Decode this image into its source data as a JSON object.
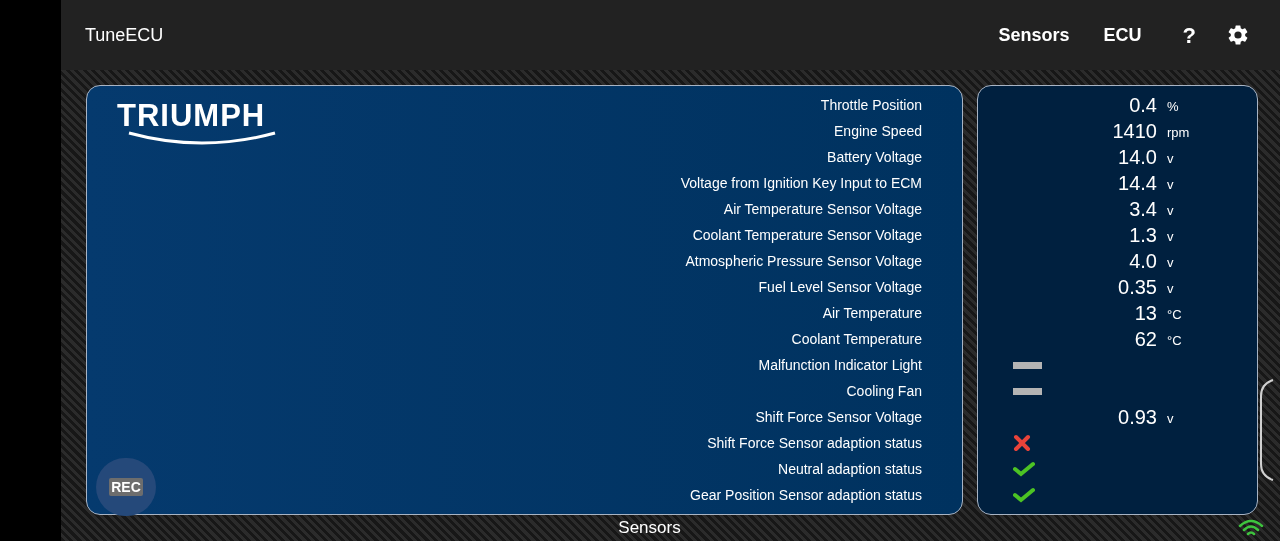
{
  "app_bar": {
    "title": "TuneECU",
    "tabs": [
      {
        "label": "Sensors"
      },
      {
        "label": "ECU"
      }
    ],
    "help": "?"
  },
  "logo": "TRIUMPH",
  "record_button": "REC",
  "sensors": [
    {
      "name": "Throttle Position",
      "kind": "reading",
      "value": "0.4",
      "unit": "%"
    },
    {
      "name": "Engine Speed",
      "kind": "reading",
      "value": "1410",
      "unit": "rpm"
    },
    {
      "name": "Battery Voltage",
      "kind": "reading",
      "value": "14.0",
      "unit": "v"
    },
    {
      "name": "Voltage from Ignition Key Input to ECM",
      "kind": "reading",
      "value": "14.4",
      "unit": "v"
    },
    {
      "name": "Air Temperature Sensor Voltage",
      "kind": "reading",
      "value": "3.4",
      "unit": "v"
    },
    {
      "name": "Coolant Temperature Sensor Voltage",
      "kind": "reading",
      "value": "1.3",
      "unit": "v"
    },
    {
      "name": "Atmospheric Pressure Sensor Voltage",
      "kind": "reading",
      "value": "4.0",
      "unit": "v"
    },
    {
      "name": "Fuel Level Sensor Voltage",
      "kind": "reading",
      "value": "0.35",
      "unit": "v"
    },
    {
      "name": "Air Temperature",
      "kind": "reading",
      "value": "13",
      "unit": "°C"
    },
    {
      "name": "Coolant Temperature",
      "kind": "reading",
      "value": "62",
      "unit": "°C"
    },
    {
      "name": "Malfunction Indicator Light",
      "kind": "off"
    },
    {
      "name": "Cooling Fan",
      "kind": "off"
    },
    {
      "name": "Shift Force Sensor Voltage",
      "kind": "reading",
      "value": "0.93",
      "unit": "v"
    },
    {
      "name": "Shift Force Sensor adaption status",
      "kind": "fail"
    },
    {
      "name": "Neutral adaption status",
      "kind": "ok"
    },
    {
      "name": "Gear Position Sensor adaption status",
      "kind": "ok"
    }
  ],
  "status_bar": {
    "label": "Sensors"
  }
}
